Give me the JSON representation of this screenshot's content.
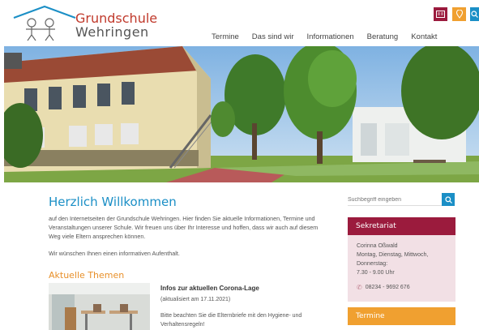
{
  "header": {
    "name_line1": "Grundschule",
    "name_line2": "Wehringen",
    "nav": [
      "Termine",
      "Das sind wir",
      "Informationen",
      "Beratung",
      "Kontakt"
    ],
    "utility_icons": [
      "newspaper-icon",
      "location-pin-icon",
      "search-icon"
    ],
    "colors": {
      "red": "#9b1b3d",
      "orange": "#f0a030",
      "blue": "#1b8fc6"
    }
  },
  "main": {
    "title": "Herzlich Willkommen",
    "intro_lines": [
      "auf den Internetseiten der Grundschule Wehringen. Hier finden Sie aktuelle Informationen, Termine und",
      "Veranstaltungen unserer Schule. Wir freuen uns über Ihr Interesse und hoffen, dass wir auch auf diesem",
      "Weg viele Eltern ansprechen können."
    ],
    "wish": "Wir wünschen Ihnen einen informativen Aufenthalt.",
    "topics_title": "Aktuelle Themen",
    "news": {
      "title": "Infos zur aktuellen Corona-Lage",
      "date": "(aktualisiert am 17.11.2021)",
      "text_lines": [
        "Bitte beachten Sie die Elternbriefe mit den Hygiene- und",
        "Verhaltensregeln!"
      ]
    }
  },
  "sidebar": {
    "search_placeholder": "Suchbegriff eingeben",
    "sekretariat": {
      "title": "Sekretariat",
      "name": "Corinna Oßwald",
      "days_line1": "Montag, Dienstag, Mittwoch,",
      "days_line2": "Donnerstag:",
      "hours": "7.30 - 9.00 Uhr",
      "phone": "08234 - 9692 676"
    },
    "termine_title": "Termine"
  }
}
